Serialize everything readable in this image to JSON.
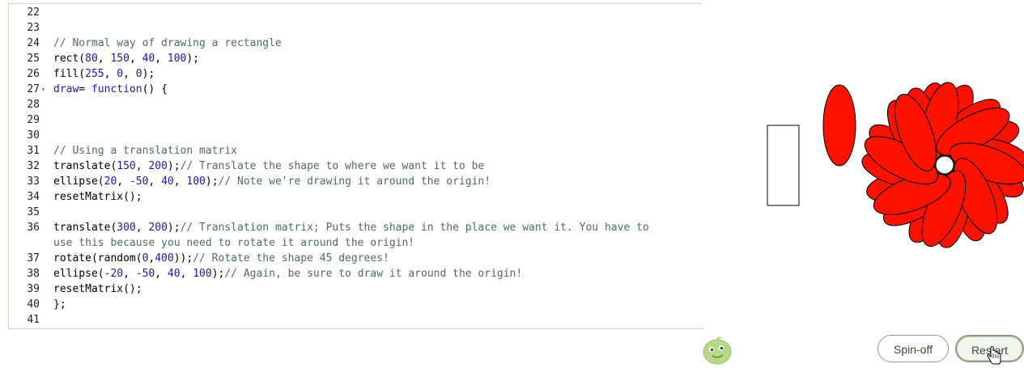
{
  "editor": {
    "lines": [
      {
        "n": "22",
        "fold": false,
        "parts": []
      },
      {
        "n": "23",
        "fold": false,
        "parts": []
      },
      {
        "n": "24",
        "fold": false,
        "parts": [
          [
            "cm",
            "// Normal way of drawing a rectangle"
          ]
        ]
      },
      {
        "n": "25",
        "fold": false,
        "parts": [
          [
            "",
            "rect("
          ],
          [
            "nm",
            "80"
          ],
          [
            "",
            ", "
          ],
          [
            "nm",
            "150"
          ],
          [
            "",
            ", "
          ],
          [
            "nm",
            "40"
          ],
          [
            "",
            ", "
          ],
          [
            "nm",
            "100"
          ],
          [
            "",
            ");"
          ]
        ]
      },
      {
        "n": "26",
        "fold": false,
        "parts": [
          [
            "",
            "fill("
          ],
          [
            "nm",
            "255"
          ],
          [
            "",
            ", "
          ],
          [
            "nm",
            "0"
          ],
          [
            "",
            ", "
          ],
          [
            "nm",
            "0"
          ],
          [
            "",
            ");"
          ]
        ]
      },
      {
        "n": "27",
        "fold": true,
        "parts": [
          [
            "kw",
            "draw"
          ],
          [
            "",
            "= "
          ],
          [
            "kw",
            "function"
          ],
          [
            "",
            "() {"
          ]
        ]
      },
      {
        "n": "28",
        "fold": false,
        "parts": []
      },
      {
        "n": "29",
        "fold": false,
        "parts": []
      },
      {
        "n": "30",
        "fold": false,
        "parts": []
      },
      {
        "n": "31",
        "fold": false,
        "parts": [
          [
            "cm",
            "// Using a translation matrix"
          ]
        ]
      },
      {
        "n": "32",
        "fold": false,
        "parts": [
          [
            "",
            "translate("
          ],
          [
            "nm",
            "150"
          ],
          [
            "",
            ", "
          ],
          [
            "nm",
            "200"
          ],
          [
            "",
            ");"
          ],
          [
            "cm",
            "// Translate the shape to where we want it to be"
          ]
        ]
      },
      {
        "n": "33",
        "fold": false,
        "parts": [
          [
            "",
            "ellipse("
          ],
          [
            "nm",
            "20"
          ],
          [
            "",
            ", "
          ],
          [
            "nm",
            "-50"
          ],
          [
            "",
            ", "
          ],
          [
            "nm",
            "40"
          ],
          [
            "",
            ", "
          ],
          [
            "nm",
            "100"
          ],
          [
            "",
            ");"
          ],
          [
            "cm",
            "// Note we're drawing it around the origin!"
          ]
        ]
      },
      {
        "n": "34",
        "fold": false,
        "parts": [
          [
            "",
            "resetMatrix();"
          ]
        ]
      },
      {
        "n": "35",
        "fold": false,
        "parts": []
      },
      {
        "n": "36",
        "fold": false,
        "parts": [
          [
            "",
            "translate("
          ],
          [
            "nm",
            "300"
          ],
          [
            "",
            ", "
          ],
          [
            "nm",
            "200"
          ],
          [
            "",
            ");"
          ],
          [
            "cm",
            "// Translation matrix; Puts the shape in the place we want it. You have to"
          ]
        ]
      },
      {
        "n": "",
        "fold": false,
        "parts": [
          [
            "cm",
            "use this because you need to rotate it around the origin!"
          ]
        ]
      },
      {
        "n": "37",
        "fold": false,
        "parts": [
          [
            "",
            "rotate(random("
          ],
          [
            "nm",
            "0"
          ],
          [
            "",
            ","
          ],
          [
            "nm",
            "400"
          ],
          [
            "",
            "));"
          ],
          [
            "cm",
            "// Rotate the shape 45 degrees!"
          ]
        ]
      },
      {
        "n": "38",
        "fold": false,
        "parts": [
          [
            "",
            "ellipse("
          ],
          [
            "nm",
            "-20"
          ],
          [
            "",
            ", "
          ],
          [
            "nm",
            "-50"
          ],
          [
            "",
            ", "
          ],
          [
            "nm",
            "40"
          ],
          [
            "",
            ", "
          ],
          [
            "nm",
            "100"
          ],
          [
            "",
            ");"
          ],
          [
            "cm",
            "// Again, be sure to draw it around the origin!"
          ]
        ]
      },
      {
        "n": "39",
        "fold": false,
        "parts": [
          [
            "",
            "resetMatrix();"
          ]
        ]
      },
      {
        "n": "40",
        "fold": false,
        "parts": [
          [
            "",
            "};"
          ]
        ]
      },
      {
        "n": "41",
        "fold": false,
        "parts": []
      }
    ]
  },
  "canvas": {
    "fill_color": "#ff1100",
    "stroke_color": "#000000"
  },
  "toolbar": {
    "spin_off_label": "Spin-off",
    "restart_label": "Restart"
  }
}
